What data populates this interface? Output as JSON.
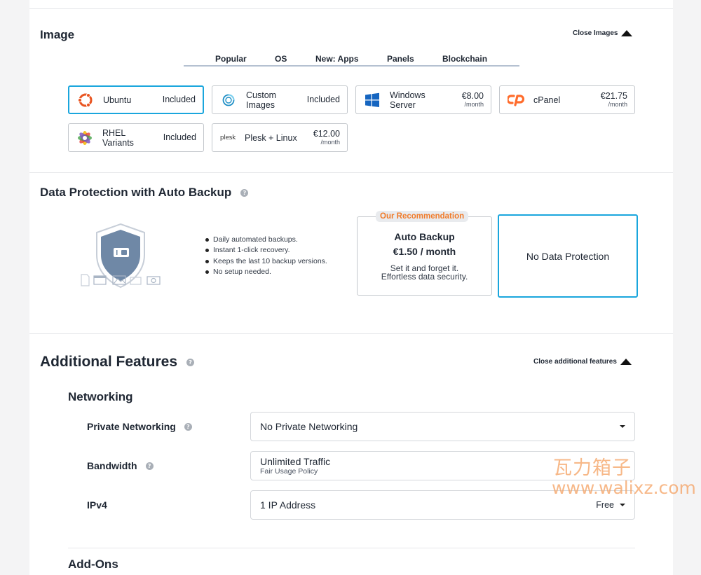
{
  "image_section": {
    "title": "Image",
    "close_label": "Close Images",
    "tabs": [
      "Popular",
      "OS",
      "New: Apps",
      "Panels",
      "Blockchain"
    ],
    "cards": [
      {
        "name": "Ubuntu",
        "price": "Included",
        "per": "",
        "icon": "ubuntu-icon"
      },
      {
        "name": "Custom\nImages",
        "price": "Included",
        "per": "",
        "icon": "custom-images-icon"
      },
      {
        "name": "Windows\nServer",
        "price": "€8.00",
        "per": "/month",
        "icon": "windows-icon"
      },
      {
        "name": "cPanel",
        "price": "€21.75",
        "per": "/month",
        "icon": "cpanel-icon"
      },
      {
        "name": "RHEL\nVariants",
        "price": "Included",
        "per": "",
        "icon": "rhel-icon"
      },
      {
        "name": "Plesk + Linux",
        "price": "€12.00",
        "per": "/month",
        "icon": "plesk-icon"
      }
    ],
    "plesk_logo_text": "plesk"
  },
  "backup_section": {
    "title": "Data Protection with Auto Backup",
    "bullets": [
      "Daily automated backups.",
      "Instant 1-click recovery.",
      "Keeps the last 10 backup versions.",
      "No setup needed."
    ],
    "recommend_badge": "Our Recommendation",
    "auto_backup": {
      "title": "Auto Backup",
      "price": "€1.50 / month",
      "desc1": "Set it and forget it.",
      "desc2": "Effortless data security."
    },
    "no_protection": "No Data Protection"
  },
  "features_section": {
    "title": "Additional Features",
    "close_label": "Close additional features",
    "networking_title": "Networking",
    "private_networking": {
      "label": "Private Networking",
      "value": "No Private Networking"
    },
    "bandwidth": {
      "label": "Bandwidth",
      "value": "Unlimited Traffic",
      "sub": "Fair Usage Policy"
    },
    "ipv4": {
      "label": "IPv4",
      "value": "1 IP Address",
      "price": "Free"
    },
    "addons_title": "Add-Ons"
  },
  "watermark": {
    "line1": "瓦力箱子",
    "line2": "www.walixz.com"
  },
  "colors": {
    "accent": "#1aa6dd",
    "badge_text": "#f07b2a",
    "shield": "#6f88a6"
  }
}
